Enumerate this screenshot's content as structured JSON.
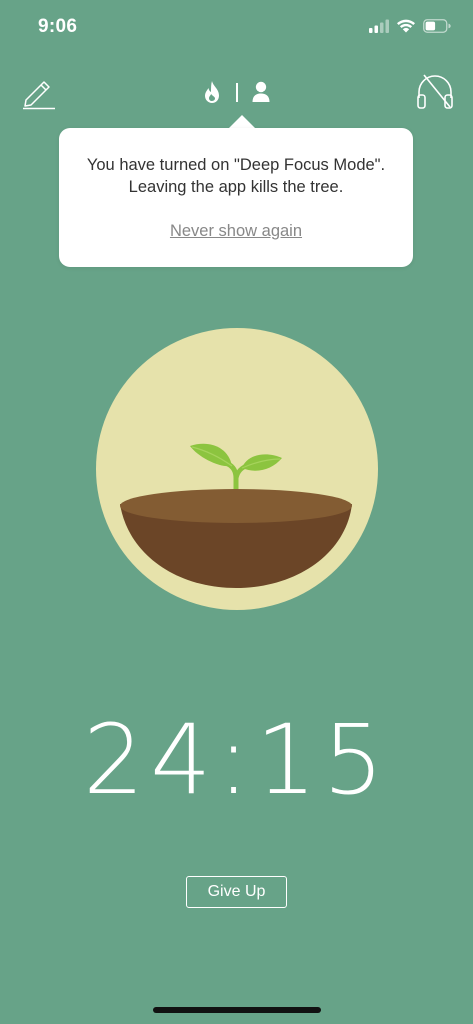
{
  "status_bar": {
    "time": "9:06",
    "signal_icon": "cellular-signal-icon",
    "wifi_icon": "wifi-icon",
    "battery_icon": "battery-icon"
  },
  "toolbar": {
    "edit_icon": "pencil-icon",
    "mode_icons": [
      "fire-icon",
      "person-icon"
    ],
    "sound_icon": "headphones-off-icon"
  },
  "tooltip": {
    "message": "You have turned on \"Deep Focus Mode\". Leaving the app kills the tree.",
    "link_label": "Never show again"
  },
  "timer": {
    "display": "24:15"
  },
  "actions": {
    "give_up_label": "Give Up"
  },
  "colors": {
    "background": "#67a388",
    "circle": "#e6e2ab",
    "soil": "#6b4527",
    "sprout": "#8cc43f"
  }
}
